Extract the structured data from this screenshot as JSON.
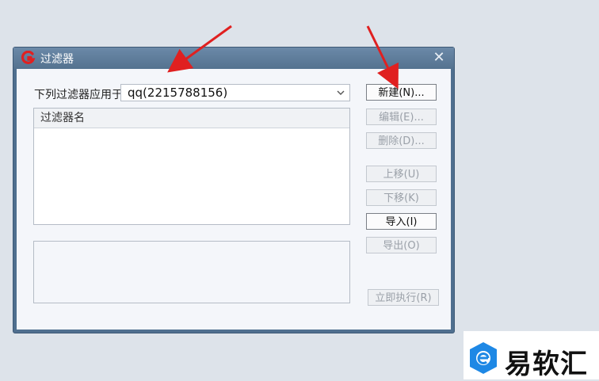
{
  "colors": {
    "accent_red": "#e02020",
    "titlebar": "#5a7898",
    "watermark_blue": "#1e88e5"
  },
  "dialog": {
    "title": "过滤器",
    "icon": "app-logo-icon",
    "close_glyph": "✕"
  },
  "apply_to": {
    "label": "下列过滤器应用于",
    "selected_account": "qq(2215788156)"
  },
  "filter_list": {
    "column_header": "过滤器名",
    "rows": []
  },
  "buttons": {
    "new": "新建(N)...",
    "edit": "编辑(E)...",
    "delete": "删除(D)...",
    "move_up": "上移(U)",
    "move_down": "下移(K)",
    "import": "导入(I)",
    "export": "导出(O)",
    "run_now": "立即执行(R)"
  },
  "annotations": {
    "arrows": [
      "red-arrow-to-account-select",
      "red-arrow-to-new-button"
    ]
  },
  "watermark": {
    "text": "易软汇"
  }
}
